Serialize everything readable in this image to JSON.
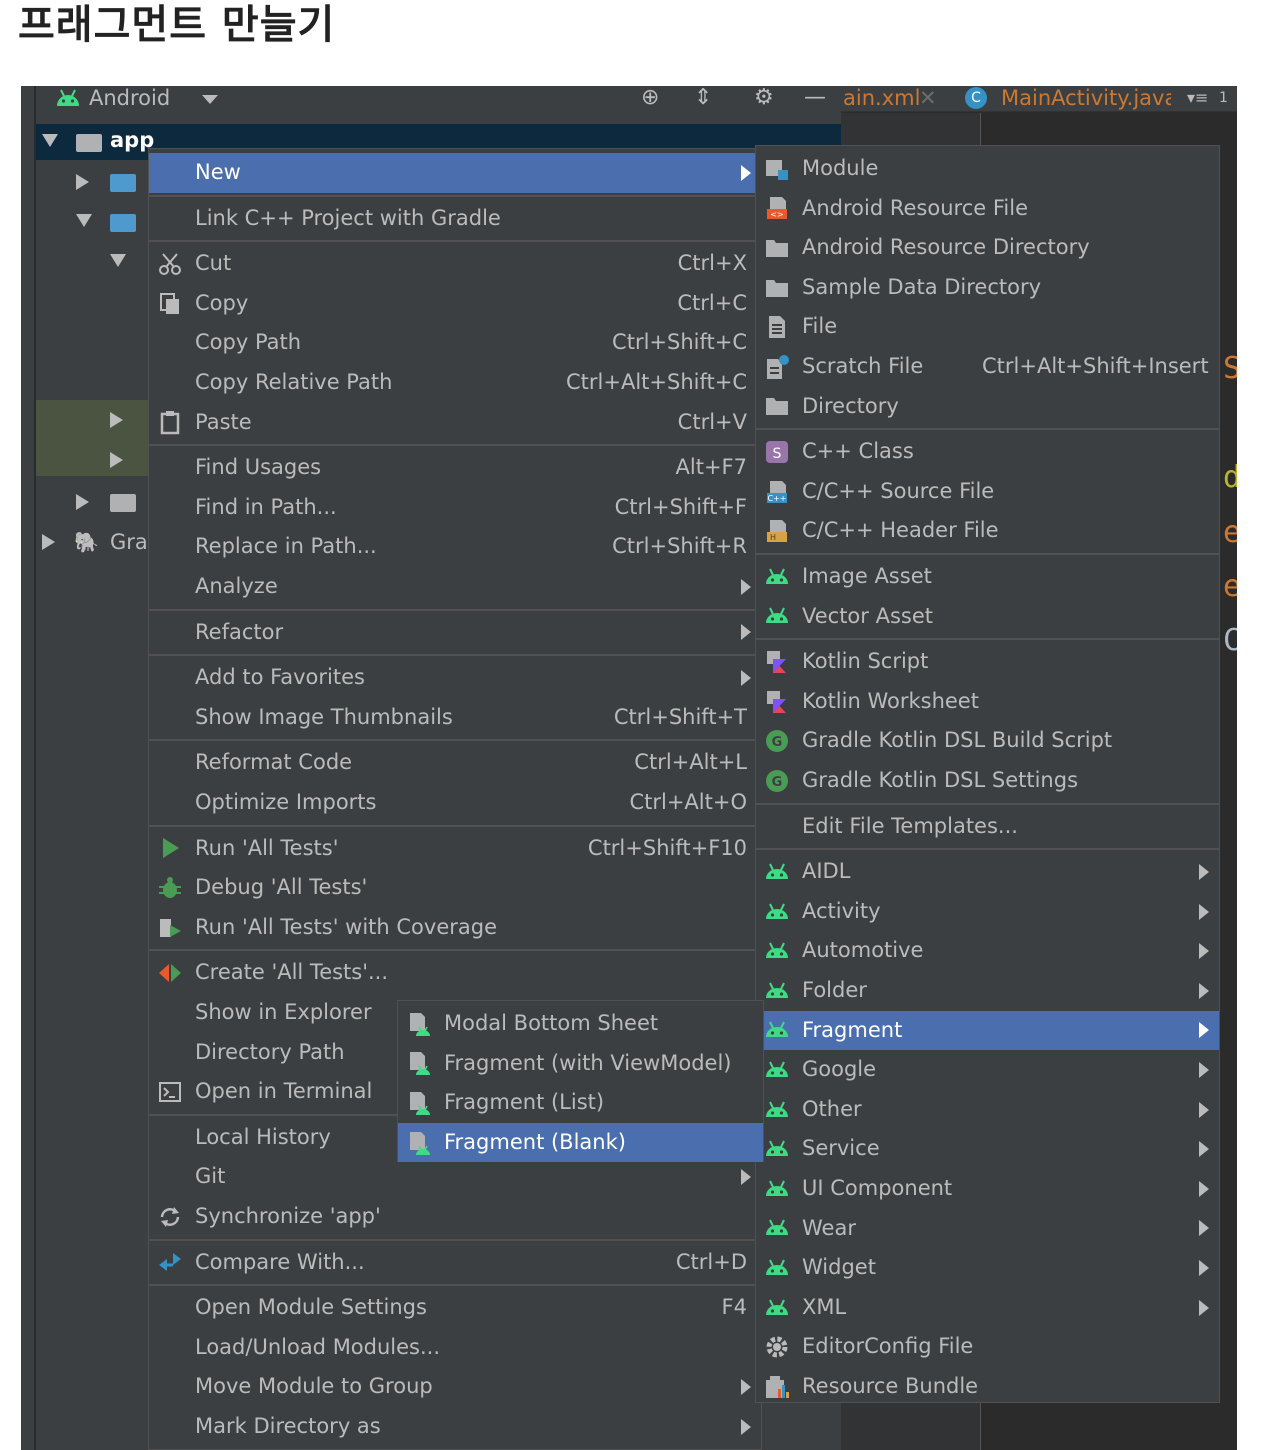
{
  "page": {
    "heading": "프래그먼트 만늘기"
  },
  "ide": {
    "project_view_label": "Android",
    "tree": {
      "root_label": "app",
      "gradle_label": "Gra"
    },
    "editor_tabs": [
      {
        "label": "ain.xml",
        "color": "#cc7832"
      },
      {
        "label": "MainActivity.java",
        "color": "#cc7832"
      }
    ],
    "tab_count": "1",
    "code_letters": [
      "S",
      "d",
      "e",
      "e",
      "C"
    ]
  },
  "context_menu": {
    "items": [
      {
        "label": "New",
        "shortcut": "",
        "submenu": true,
        "icon": "",
        "highlighted": true
      },
      {
        "label": "Link C++ Project with Gradle",
        "shortcut": "",
        "submenu": false,
        "icon": ""
      },
      {
        "label": "Cut",
        "shortcut": "Ctrl+X",
        "submenu": false,
        "icon": "scissors-icon"
      },
      {
        "label": "Copy",
        "shortcut": "Ctrl+C",
        "submenu": false,
        "icon": "copy-icon"
      },
      {
        "label": "Copy Path",
        "shortcut": "Ctrl+Shift+C",
        "submenu": false,
        "icon": ""
      },
      {
        "label": "Copy Relative Path",
        "shortcut": "Ctrl+Alt+Shift+C",
        "submenu": false,
        "icon": ""
      },
      {
        "label": "Paste",
        "shortcut": "Ctrl+V",
        "submenu": false,
        "icon": "clipboard-icon"
      },
      {
        "label": "Find Usages",
        "shortcut": "Alt+F7",
        "submenu": false,
        "icon": ""
      },
      {
        "label": "Find in Path...",
        "shortcut": "Ctrl+Shift+F",
        "submenu": false,
        "icon": ""
      },
      {
        "label": "Replace in Path...",
        "shortcut": "Ctrl+Shift+R",
        "submenu": false,
        "icon": ""
      },
      {
        "label": "Analyze",
        "shortcut": "",
        "submenu": true,
        "icon": ""
      },
      {
        "label": "Refactor",
        "shortcut": "",
        "submenu": true,
        "icon": ""
      },
      {
        "label": "Add to Favorites",
        "shortcut": "",
        "submenu": true,
        "icon": ""
      },
      {
        "label": "Show Image Thumbnails",
        "shortcut": "Ctrl+Shift+T",
        "submenu": false,
        "icon": ""
      },
      {
        "label": "Reformat Code",
        "shortcut": "Ctrl+Alt+L",
        "submenu": false,
        "icon": ""
      },
      {
        "label": "Optimize Imports",
        "shortcut": "Ctrl+Alt+O",
        "submenu": false,
        "icon": ""
      },
      {
        "label": "Run 'All Tests'",
        "shortcut": "Ctrl+Shift+F10",
        "submenu": false,
        "icon": "run-icon"
      },
      {
        "label": "Debug 'All Tests'",
        "shortcut": "",
        "submenu": false,
        "icon": "debug-icon"
      },
      {
        "label": "Run 'All Tests' with Coverage",
        "shortcut": "",
        "submenu": false,
        "icon": "coverage-icon"
      },
      {
        "label": "Create 'All Tests'...",
        "shortcut": "",
        "submenu": false,
        "icon": "create-test-icon"
      },
      {
        "label": "Show in Explorer",
        "shortcut": "",
        "submenu": false,
        "icon": ""
      },
      {
        "label": "Directory Path",
        "shortcut": "",
        "submenu": false,
        "icon": ""
      },
      {
        "label": "Open in Terminal",
        "shortcut": "",
        "submenu": false,
        "icon": "terminal-icon"
      },
      {
        "label": "Local History",
        "shortcut": "",
        "submenu": false,
        "icon": ""
      },
      {
        "label": "Git",
        "shortcut": "",
        "submenu": true,
        "icon": ""
      },
      {
        "label": "Synchronize 'app'",
        "shortcut": "",
        "submenu": false,
        "icon": "sync-icon"
      },
      {
        "label": "Compare With...",
        "shortcut": "Ctrl+D",
        "submenu": false,
        "icon": "compare-icon"
      },
      {
        "label": "Open Module Settings",
        "shortcut": "F4",
        "submenu": false,
        "icon": ""
      },
      {
        "label": "Load/Unload Modules...",
        "shortcut": "",
        "submenu": false,
        "icon": ""
      },
      {
        "label": "Move Module to Group",
        "shortcut": "",
        "submenu": true,
        "icon": ""
      },
      {
        "label": "Mark Directory as",
        "shortcut": "",
        "submenu": true,
        "icon": ""
      }
    ]
  },
  "new_submenu": {
    "items": [
      {
        "label": "Module",
        "shortcut": "",
        "submenu": false,
        "icon": "module-icon"
      },
      {
        "label": "Android Resource File",
        "shortcut": "",
        "submenu": false,
        "icon": "resource-file-icon"
      },
      {
        "label": "Android Resource Directory",
        "shortcut": "",
        "submenu": false,
        "icon": "folder-icon"
      },
      {
        "label": "Sample Data Directory",
        "shortcut": "",
        "submenu": false,
        "icon": "folder-icon"
      },
      {
        "label": "File",
        "shortcut": "",
        "submenu": false,
        "icon": "file-icon"
      },
      {
        "label": "Scratch File",
        "shortcut": "Ctrl+Alt+Shift+Insert",
        "submenu": false,
        "icon": "scratch-file-icon"
      },
      {
        "label": "Directory",
        "shortcut": "",
        "submenu": false,
        "icon": "folder-icon"
      },
      {
        "label": "C++ Class",
        "shortcut": "",
        "submenu": false,
        "icon": "cpp-class-icon"
      },
      {
        "label": "C/C++ Source File",
        "shortcut": "",
        "submenu": false,
        "icon": "cpp-source-icon"
      },
      {
        "label": "C/C++ Header File",
        "shortcut": "",
        "submenu": false,
        "icon": "cpp-header-icon"
      },
      {
        "label": "Image Asset",
        "shortcut": "",
        "submenu": false,
        "icon": "android-icon"
      },
      {
        "label": "Vector Asset",
        "shortcut": "",
        "submenu": false,
        "icon": "android-icon"
      },
      {
        "label": "Kotlin Script",
        "shortcut": "",
        "submenu": false,
        "icon": "kotlin-icon"
      },
      {
        "label": "Kotlin Worksheet",
        "shortcut": "",
        "submenu": false,
        "icon": "kotlin-icon"
      },
      {
        "label": "Gradle Kotlin DSL Build Script",
        "shortcut": "",
        "submenu": false,
        "icon": "gradle-icon"
      },
      {
        "label": "Gradle Kotlin DSL Settings",
        "shortcut": "",
        "submenu": false,
        "icon": "gradle-icon"
      },
      {
        "label": "Edit File Templates...",
        "shortcut": "",
        "submenu": false,
        "icon": ""
      },
      {
        "label": "AIDL",
        "shortcut": "",
        "submenu": true,
        "icon": "android-icon"
      },
      {
        "label": "Activity",
        "shortcut": "",
        "submenu": true,
        "icon": "android-icon"
      },
      {
        "label": "Automotive",
        "shortcut": "",
        "submenu": true,
        "icon": "android-icon"
      },
      {
        "label": "Folder",
        "shortcut": "",
        "submenu": true,
        "icon": "android-icon"
      },
      {
        "label": "Fragment",
        "shortcut": "",
        "submenu": true,
        "icon": "android-icon",
        "highlighted": true
      },
      {
        "label": "Google",
        "shortcut": "",
        "submenu": true,
        "icon": "android-icon"
      },
      {
        "label": "Other",
        "shortcut": "",
        "submenu": true,
        "icon": "android-icon"
      },
      {
        "label": "Service",
        "shortcut": "",
        "submenu": true,
        "icon": "android-icon"
      },
      {
        "label": "UI Component",
        "shortcut": "",
        "submenu": true,
        "icon": "android-icon"
      },
      {
        "label": "Wear",
        "shortcut": "",
        "submenu": true,
        "icon": "android-icon"
      },
      {
        "label": "Widget",
        "shortcut": "",
        "submenu": true,
        "icon": "android-icon"
      },
      {
        "label": "XML",
        "shortcut": "",
        "submenu": true,
        "icon": "android-icon"
      },
      {
        "label": "EditorConfig File",
        "shortcut": "",
        "submenu": false,
        "icon": "gear-icon"
      },
      {
        "label": "Resource Bundle",
        "shortcut": "",
        "submenu": false,
        "icon": "resource-bundle-icon"
      }
    ]
  },
  "fragment_submenu": {
    "items": [
      {
        "label": "Modal Bottom Sheet",
        "icon": "android-file-icon"
      },
      {
        "label": "Fragment (with ViewModel)",
        "icon": "android-file-icon"
      },
      {
        "label": "Fragment (List)",
        "icon": "android-file-icon"
      },
      {
        "label": "Fragment (Blank)",
        "icon": "android-file-icon",
        "highlighted": true
      }
    ]
  },
  "colors": {
    "menu_bg": "#3c3f41",
    "highlight": "#4b6eaf",
    "android_green": "#3ddc84",
    "text": "#bbbbbb"
  }
}
